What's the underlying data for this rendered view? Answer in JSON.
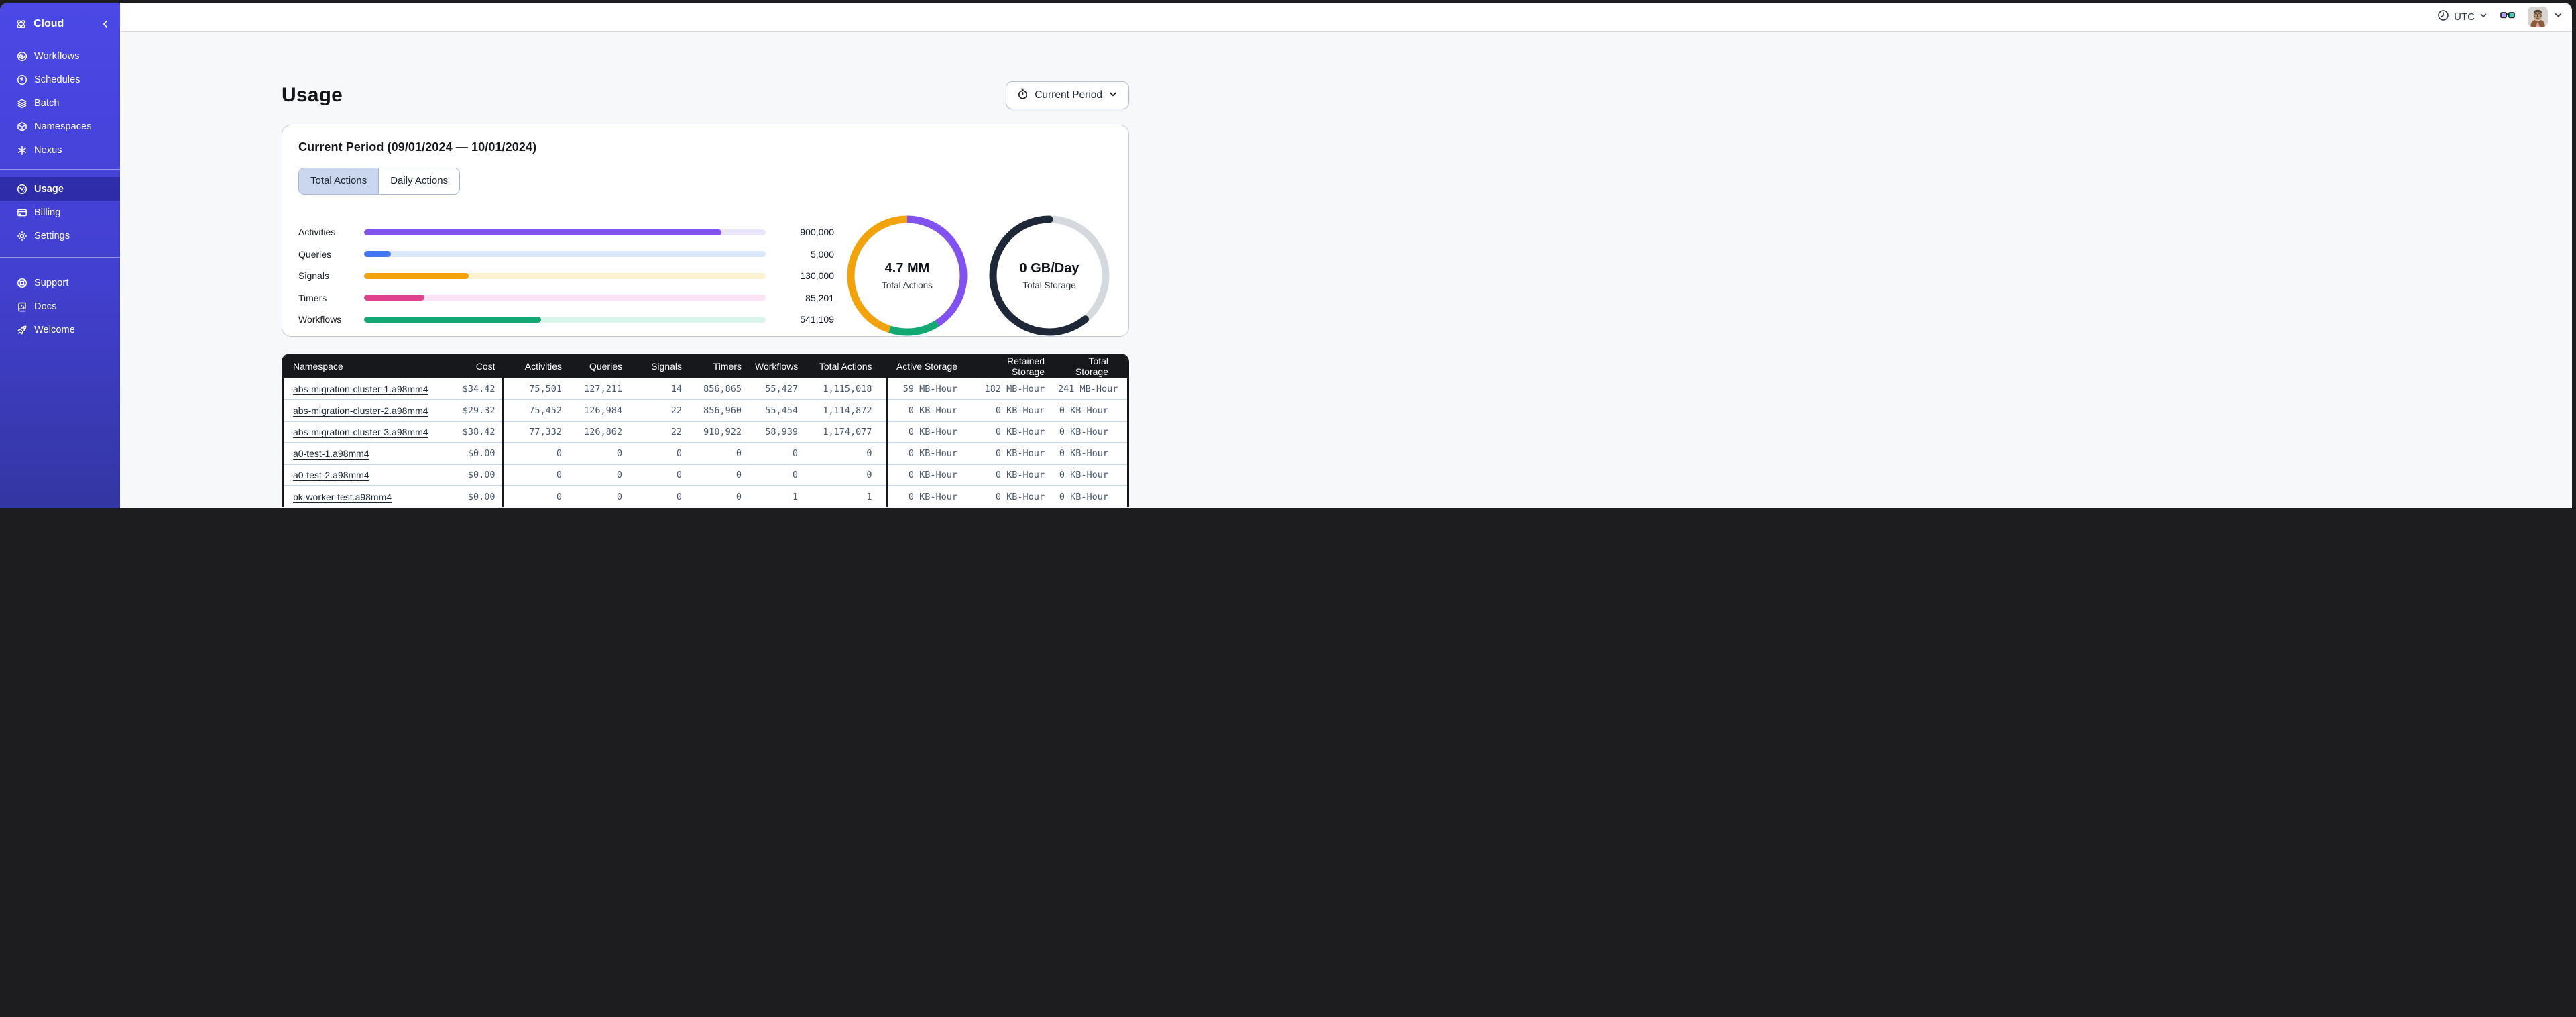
{
  "sidebar": {
    "brand_label": "Cloud",
    "items": [
      {
        "label": "Workflows"
      },
      {
        "label": "Schedules"
      },
      {
        "label": "Batch"
      },
      {
        "label": "Namespaces"
      },
      {
        "label": "Nexus"
      }
    ],
    "account_items": [
      {
        "label": "Usage",
        "active": true
      },
      {
        "label": "Billing"
      },
      {
        "label": "Settings"
      }
    ],
    "footer_items": [
      {
        "label": "Support"
      },
      {
        "label": "Docs"
      },
      {
        "label": "Welcome"
      }
    ]
  },
  "topbar": {
    "timezone": "UTC"
  },
  "page": {
    "title": "Usage"
  },
  "period_button": {
    "label": "Current Period"
  },
  "card": {
    "title": "Current Period (09/01/2024 — 10/01/2024)",
    "tabs": [
      {
        "label": "Total Actions",
        "active": true
      },
      {
        "label": "Daily Actions",
        "active": false
      }
    ]
  },
  "chart_data": [
    {
      "type": "bar",
      "orientation": "horizontal",
      "categories": [
        "Activities",
        "Queries",
        "Signals",
        "Timers",
        "Workflows"
      ],
      "values": [
        900000,
        5000,
        130000,
        85201,
        541109
      ],
      "value_labels": [
        "900,000",
        "5,000",
        "130,000",
        "85,201",
        "541,109"
      ],
      "fill_percent": [
        89,
        6.7,
        26,
        15,
        44
      ],
      "bar_colors": [
        "#8152ef",
        "#4178f2",
        "#f2a30c",
        "#e0418f",
        "#12a874"
      ],
      "track_colors": [
        "#eae4fb",
        "#dbe7fd",
        "#fcf1d0",
        "#fbe3f3",
        "#d9f4e8"
      ]
    },
    {
      "type": "donut",
      "center_value": "4.7 MM",
      "center_label": "Total Actions",
      "segments": [
        {
          "name": "activities",
          "color": "#8152ef",
          "percent": 41
        },
        {
          "name": "workflows",
          "color": "#12a874",
          "percent": 14
        },
        {
          "name": "other-actions",
          "color": "#f2a30c",
          "percent": 45
        }
      ]
    },
    {
      "type": "donut",
      "center_value": "0 GB/Day",
      "center_label": "Total Storage",
      "segments": [
        {
          "name": "remaining",
          "color": "#d5d8dd",
          "percent": 39
        },
        {
          "name": "storage",
          "color": "#1d2737",
          "percent": 61,
          "cap": "round"
        }
      ]
    }
  ],
  "table": {
    "columns": [
      "Namespace",
      "Cost",
      "Activities",
      "Queries",
      "Signals",
      "Timers",
      "Workflows",
      "Total Actions",
      "Active Storage",
      "Retained Storage",
      "Total Storage"
    ],
    "rows": [
      [
        "abs-migration-cluster-1.a98mm4",
        "$34.42",
        "75,501",
        "127,211",
        "14",
        "856,865",
        "55,427",
        "1,115,018",
        "59 MB-Hour",
        "182 MB-Hour",
        "241 MB-Hour"
      ],
      [
        "abs-migration-cluster-2.a98mm4",
        "$29.32",
        "75,452",
        "126,984",
        "22",
        "856,960",
        "55,454",
        "1,114,872",
        "0 KB-Hour",
        "0 KB-Hour",
        "0 KB-Hour"
      ],
      [
        "abs-migration-cluster-3.a98mm4",
        "$38.42",
        "77,332",
        "126,862",
        "22",
        "910,922",
        "58,939",
        "1,174,077",
        "0 KB-Hour",
        "0 KB-Hour",
        "0 KB-Hour"
      ],
      [
        "a0-test-1.a98mm4",
        "$0.00",
        "0",
        "0",
        "0",
        "0",
        "0",
        "0",
        "0 KB-Hour",
        "0 KB-Hour",
        "0 KB-Hour"
      ],
      [
        "a0-test-2.a98mm4",
        "$0.00",
        "0",
        "0",
        "0",
        "0",
        "0",
        "0",
        "0 KB-Hour",
        "0 KB-Hour",
        "0 KB-Hour"
      ],
      [
        "bk-worker-test.a98mm4",
        "$0.00",
        "0",
        "0",
        "0",
        "0",
        "1",
        "1",
        "0 KB-Hour",
        "0 KB-Hour",
        "0 KB-Hour"
      ]
    ]
  }
}
